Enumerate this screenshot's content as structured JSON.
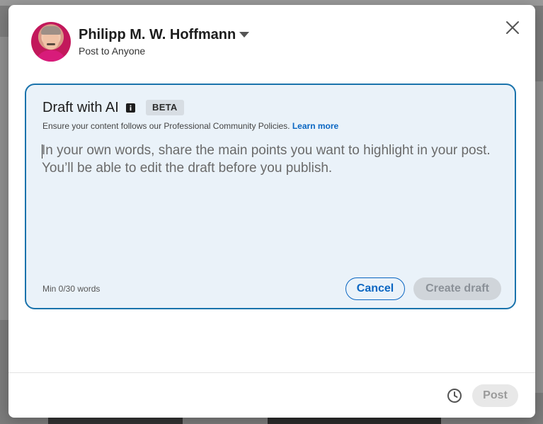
{
  "author": {
    "name": "Philipp M. W. Hoffmann",
    "audience": "Post to Anyone"
  },
  "ai_panel": {
    "title": "Draft with AI",
    "badge": "BETA",
    "policy_text": "Ensure your content follows our Professional Community Policies.",
    "learn_more": "Learn more",
    "prompt_placeholder": "In your own words, share the main points you want to highlight in your post. You’ll be able to edit the draft before you publish.",
    "prompt_value": "",
    "word_count": "Min 0/30 words",
    "cancel_label": "Cancel",
    "create_label": "Create draft"
  },
  "footer": {
    "post_label": "Post"
  },
  "colors": {
    "accent": "#0a66c2",
    "panel_border": "#1a73ac",
    "panel_bg": "#eaf2f9"
  },
  "icons": {
    "close": "close-icon",
    "info": "info-icon",
    "caret": "caret-down-icon",
    "schedule": "clock-icon"
  }
}
